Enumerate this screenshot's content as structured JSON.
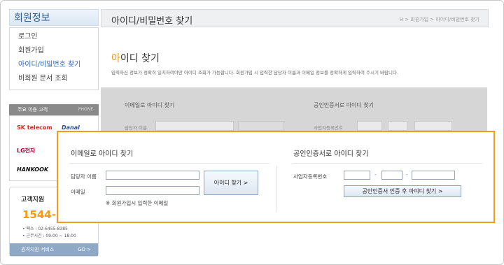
{
  "sidebar": {
    "title": "회원정보",
    "items": [
      {
        "label": "로그인",
        "active": false
      },
      {
        "label": "회원가입",
        "active": false
      },
      {
        "label": "아이디/비밀번호 찾기",
        "active": true
      },
      {
        "label": "비회원 문서 조회",
        "active": false
      }
    ],
    "partners_title": "주요 이용 고객",
    "partners_sub": "PHONE",
    "partners": [
      "SK telecom",
      "Danal",
      "LG전자",
      "HANKOOK"
    ],
    "support": {
      "title": "고객지원",
      "number": "1544-",
      "fax": "• 팩스      : 02-6455-8385",
      "hours": "• 근무시간 : 09:00 ~ 18:00",
      "remote_label": "원격지원 서비스",
      "go_label": "GO >"
    }
  },
  "header": {
    "title": "아이디/비밀번호 찾기",
    "breadcrumb": "H > 회원가입 > 아이디/비밀번호 찾기"
  },
  "section": {
    "title_first": "아",
    "title_rest": "이디 찾기",
    "description": "입력하신 정보가 정확히 일치하여야만 아이디 조회가 가능합니다. 회원가입 시 입력한 담당자 이름과 이메일 정보를 정확하게 입력하여 주시기 바랍니다."
  },
  "background_form": {
    "email_title": "이메일로 아이디 찾기",
    "name_label": "담당자 이름",
    "cert_title": "공인인증서로 아이디 찾기",
    "bizno_label": "사업자등록번호"
  },
  "popup": {
    "email_section": {
      "title": "이메일로 아이디 찾기",
      "name_label": "담당자 이름",
      "email_label": "이메일",
      "name_value": "",
      "email_value": "",
      "submit_label": "아이디 찾기 >",
      "note": "※ 회원가입시 입력한 이메일"
    },
    "cert_section": {
      "title": "공인인증서로 아이디 찾기",
      "bizno_label": "사업자등록번호",
      "separator": "-",
      "submit_label": "공인인증서 인증 후 아이디 찾기 >"
    }
  },
  "colors": {
    "accent": "#f39b1b",
    "link_active": "#2f6ab5"
  }
}
